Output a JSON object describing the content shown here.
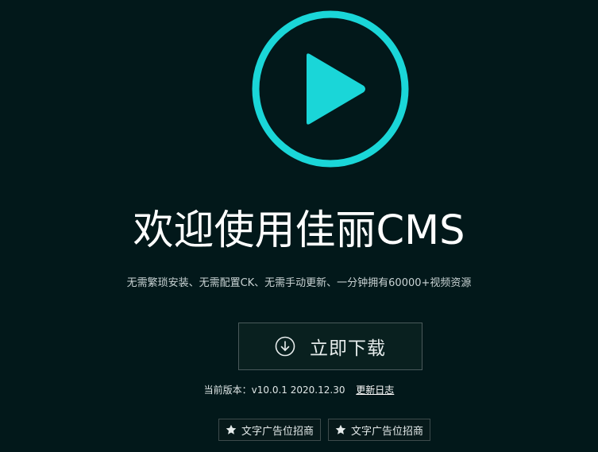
{
  "logo": {
    "icon": "play-circle-icon",
    "color": "#1ad6d8"
  },
  "hero": {
    "title": "欢迎使用佳丽CMS",
    "subtitle": "无需繁琐安装、无需配置CK、无需手动更新、一分钟拥有60000+视频资源"
  },
  "download": {
    "icon": "download-circle-icon",
    "label": "立即下载"
  },
  "version": {
    "text": "当前版本：v10.0.1 2020.12.30",
    "changelog_label": "更新日志"
  },
  "ads": [
    {
      "icon": "star-icon",
      "label": "文字广告位招商"
    },
    {
      "icon": "star-icon",
      "label": "文字广告位招商"
    }
  ]
}
